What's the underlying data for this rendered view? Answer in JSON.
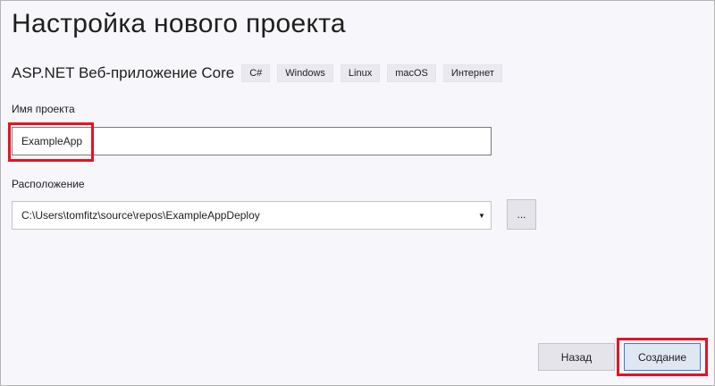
{
  "page": {
    "title": "Настройка нового проекта"
  },
  "template": {
    "name": "ASP.NET Веб-приложение Core",
    "tags": [
      "C#",
      "Windows",
      "Linux",
      "macOS",
      "Интернет"
    ]
  },
  "form": {
    "project_name_label": "Имя проекта",
    "project_name_value": "ExampleApp",
    "location_label": "Расположение",
    "location_value": "C:\\Users\\tomfitz\\source\\repos\\ExampleAppDeploy",
    "browse_label": "..."
  },
  "footer": {
    "back_label": "Назад",
    "create_label": "Создание"
  },
  "colors": {
    "highlight": "#e81123",
    "background": "#f7f7fb",
    "primary_border": "#3d7bd9"
  }
}
